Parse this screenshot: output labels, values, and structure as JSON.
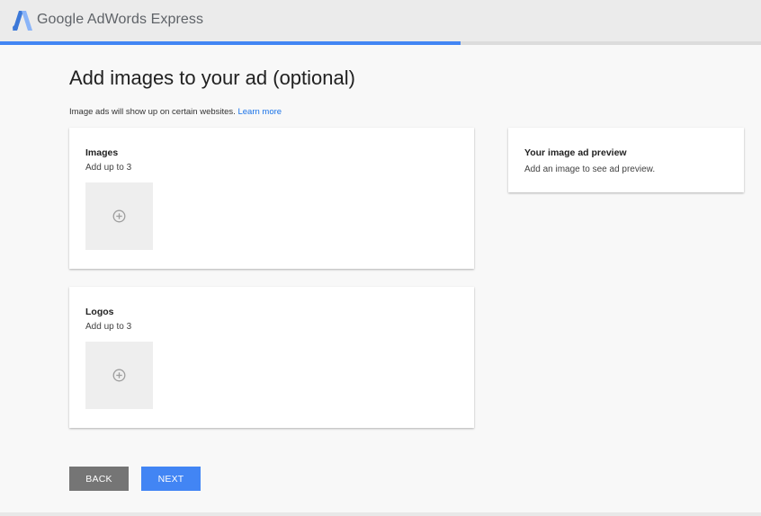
{
  "app": {
    "logo_text": "Google AdWords Express"
  },
  "progress": {
    "fraction": 0.605,
    "accent_color": "#4285f4"
  },
  "page": {
    "title": "Add images to your ad (optional)",
    "subtitle": "Image ads will show up on certain websites.",
    "learn_more_link": "Learn more"
  },
  "images_card": {
    "title": "Images",
    "limit_text": "Add up to 3",
    "add_icon": "add-circle-icon"
  },
  "logos_card": {
    "title": "Logos",
    "limit_text": "Add up to 3",
    "add_icon": "add-circle-icon"
  },
  "preview_card": {
    "title": "Your image ad preview",
    "text": "Add an image to see ad preview."
  },
  "buttons": {
    "back_label": "BACK",
    "next_label": "NEXT",
    "back_color": "#757575",
    "next_color": "#4285f4"
  }
}
